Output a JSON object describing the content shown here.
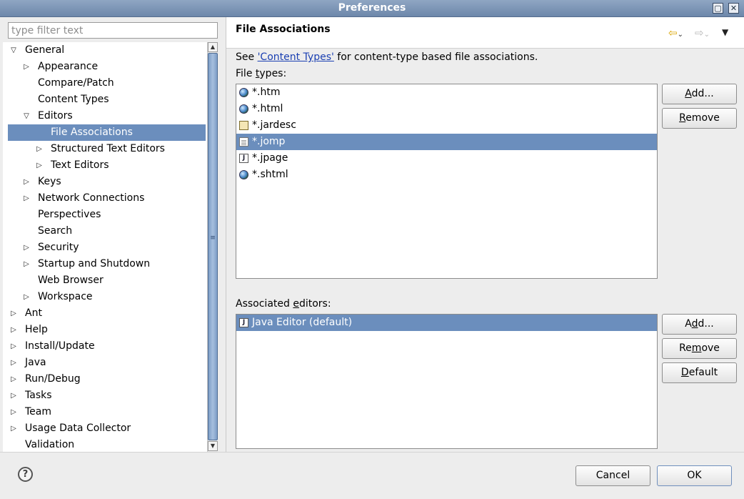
{
  "window": {
    "title": "Preferences",
    "btn_maximize": "▢",
    "btn_close": "✕"
  },
  "filter": {
    "placeholder": "type filter text"
  },
  "tree": {
    "items": [
      {
        "label": "General",
        "expanded": true
      },
      {
        "label": "Appearance",
        "expanded": false
      },
      {
        "label": "Compare/Patch"
      },
      {
        "label": "Content Types"
      },
      {
        "label": "Editors",
        "expanded": true
      },
      {
        "label": "File Associations",
        "selected": true
      },
      {
        "label": "Structured Text Editors",
        "expanded": false
      },
      {
        "label": "Text Editors",
        "expanded": false
      },
      {
        "label": "Keys",
        "expanded": false
      },
      {
        "label": "Network Connections",
        "expanded": false
      },
      {
        "label": "Perspectives"
      },
      {
        "label": "Search"
      },
      {
        "label": "Security",
        "expanded": false
      },
      {
        "label": "Startup and Shutdown",
        "expanded": false
      },
      {
        "label": "Web Browser"
      },
      {
        "label": "Workspace",
        "expanded": false
      },
      {
        "label": "Ant",
        "expanded": false
      },
      {
        "label": "Help",
        "expanded": false
      },
      {
        "label": "Install/Update",
        "expanded": false
      },
      {
        "label": "Java",
        "expanded": false
      },
      {
        "label": "Run/Debug",
        "expanded": false
      },
      {
        "label": "Tasks",
        "expanded": false
      },
      {
        "label": "Team",
        "expanded": false
      },
      {
        "label": "Usage Data Collector",
        "expanded": false
      },
      {
        "label": "Validation"
      }
    ]
  },
  "page": {
    "title": "File Associations",
    "intro_prefix": "See ",
    "intro_link": "'Content Types'",
    "intro_suffix": " for content-type based file associations.",
    "file_types_label": "File types:",
    "file_types": [
      {
        "name": "*.htm",
        "icon": "globe-icon"
      },
      {
        "name": "*.html",
        "icon": "globe-icon"
      },
      {
        "name": "*.jardesc",
        "icon": "jar-description-icon"
      },
      {
        "name": "*.jomp",
        "icon": "document-icon",
        "selected": true
      },
      {
        "name": "*.jpage",
        "icon": "java-file-icon"
      },
      {
        "name": "*.shtml",
        "icon": "globe-icon"
      }
    ],
    "file_types_buttons": {
      "add": "Add...",
      "remove": "Remove"
    },
    "editors_label": "Associated editors:",
    "editors": [
      {
        "name": "Java Editor (default)",
        "icon": "java-file-icon",
        "selected": true
      }
    ],
    "editors_buttons": {
      "add": "Add...",
      "remove": "Remove",
      "default": "Default"
    }
  },
  "nav": {
    "back_icon": "⇦",
    "back_menu": "⌄",
    "forward_icon": "⇨",
    "forward_menu": "⌄",
    "menu_icon": "▼"
  },
  "footer": {
    "help": "?",
    "cancel": "Cancel",
    "ok": "OK"
  },
  "colors": {
    "selection": "#6b8ebd",
    "titlebar": "#7e96b8",
    "link": "#1a3fb2"
  }
}
